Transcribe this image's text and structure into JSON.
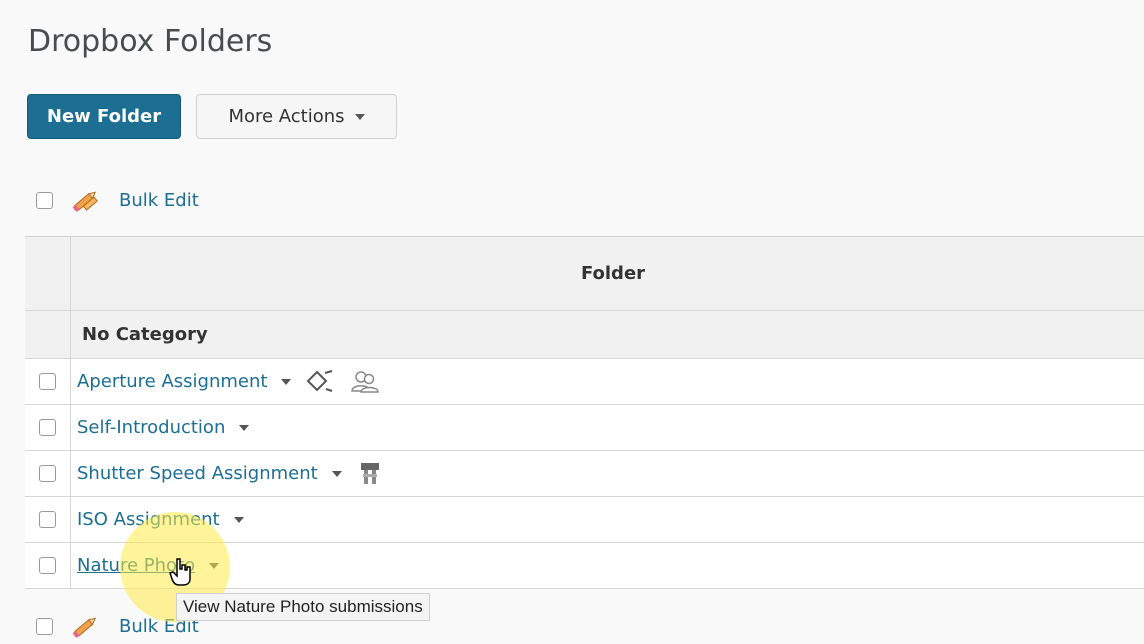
{
  "page_title": "Dropbox Folders",
  "toolbar": {
    "new_folder_label": "New Folder",
    "more_actions_label": "More Actions"
  },
  "bulk_edit_label": "Bulk Edit",
  "table": {
    "header": "Folder",
    "category": "No Category",
    "rows": [
      {
        "name": "Aperture Assignment"
      },
      {
        "name": "Self-Introduction"
      },
      {
        "name": "Shutter Speed Assignment"
      },
      {
        "name": "ISO Assignment"
      },
      {
        "name": "Nature Photo"
      }
    ]
  },
  "tooltip_text": "View Nature Photo submissions",
  "colors": {
    "accent": "#1c6e93",
    "highlight": "#ffeb46"
  }
}
